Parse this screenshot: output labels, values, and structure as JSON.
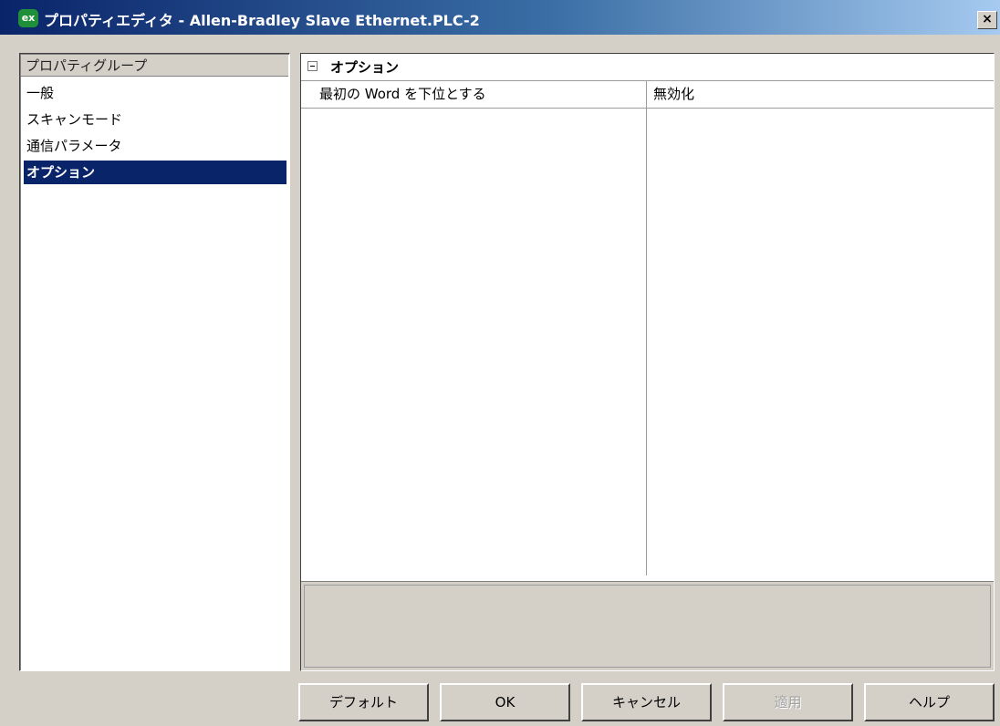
{
  "window": {
    "icon_text": "ex",
    "title": "プロパティエディタ - Allen-Bradley Slave Ethernet.PLC-2",
    "close_label": "×"
  },
  "groups": {
    "header": "プロパティグループ",
    "items": [
      {
        "label": "一般",
        "selected": false
      },
      {
        "label": "スキャンモード",
        "selected": false
      },
      {
        "label": "通信パラメータ",
        "selected": false
      },
      {
        "label": "オプション",
        "selected": true
      }
    ]
  },
  "properties": {
    "section_title": "オプション",
    "rows": [
      {
        "name": "最初の Word を下位とする",
        "value": "無効化"
      }
    ]
  },
  "buttons": {
    "default_label": "デフォルト",
    "ok_label": "OK",
    "cancel_label": "キャンセル",
    "apply_label": "適用",
    "help_label": "ヘルプ"
  }
}
